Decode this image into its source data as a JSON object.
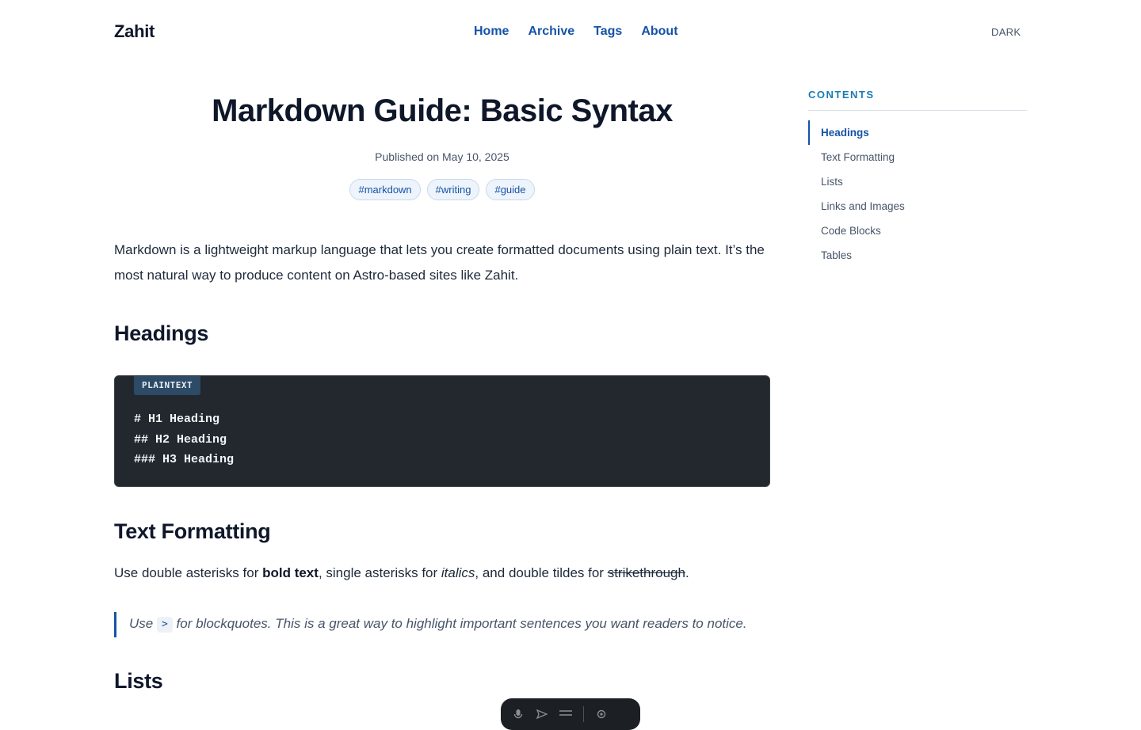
{
  "site": {
    "logo": "Zahit",
    "nav": [
      "Home",
      "Archive",
      "Tags",
      "About"
    ],
    "theme_toggle": "DARK"
  },
  "post": {
    "title": "Markdown Guide: Basic Syntax",
    "published": "Published on May 10, 2025",
    "tags": [
      "#markdown",
      "#writing",
      "#guide"
    ],
    "intro": "Markdown is a lightweight markup language that lets you create formatted documents using plain text. It’s the most natural way to produce content on Astro-based sites like Zahit.",
    "sections": {
      "headings": {
        "title": "Headings",
        "code_lang": "PLAINTEXT",
        "code_lines": [
          "# H1 Heading",
          "## H2 Heading",
          "### H3 Heading"
        ]
      },
      "formatting": {
        "title": "Text Formatting",
        "text_1": "Use double asterisks for ",
        "bold": "bold text",
        "text_2": ", single asterisks for ",
        "italic": "italics",
        "text_3": ", and double tildes for ",
        "strike": "strikethrough",
        "text_4": ".",
        "quote_1": "Use ",
        "quote_code": ">",
        "quote_2": " for blockquotes. This is a great way to highlight important sentences you want readers to notice."
      },
      "lists": {
        "title": "Lists"
      }
    }
  },
  "toc": {
    "title": "CONTENTS",
    "items": [
      "Headings",
      "Text Formatting",
      "Lists",
      "Links and Images",
      "Code Blocks",
      "Tables"
    ],
    "active": "Headings"
  },
  "floating_toolbar": {
    "icons": [
      "microphone-icon",
      "send-icon",
      "menu-icon",
      "settings-icon"
    ]
  },
  "colors": {
    "accent": "#1553a8",
    "code_bg": "#23282e",
    "text": "#0f172a"
  }
}
